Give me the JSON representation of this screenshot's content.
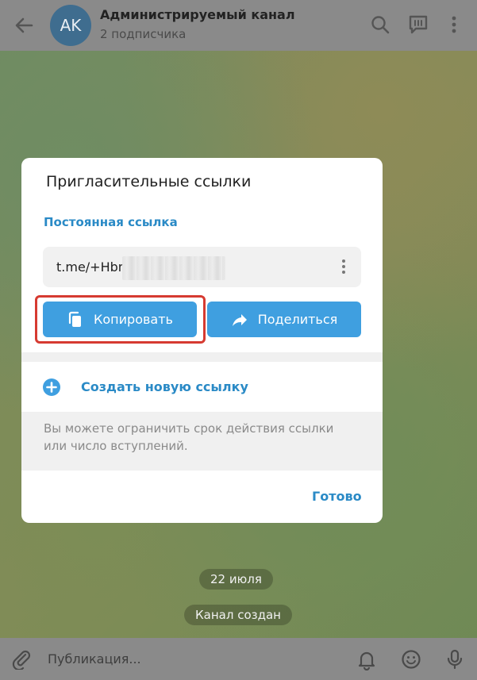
{
  "header": {
    "avatar_initials": "AK",
    "title": "Администрируемый канал",
    "subtitle": "2 подписчика"
  },
  "chat": {
    "date_pill": "22 июля",
    "system_message": "Канал создан"
  },
  "composer": {
    "placeholder": "Публикация..."
  },
  "dialog": {
    "title": "Пригласительные ссылки",
    "section_label": "Постоянная ссылка",
    "link_text": "t.me/+Hbm",
    "copy_button": "Копировать",
    "share_button": "Поделиться",
    "create_new_link": "Создать новую ссылку",
    "note": "Вы можете ограничить срок действия ссылки или число вступлений.",
    "done_button": "Готово"
  },
  "colors": {
    "accent": "#3f9fe0",
    "link_blue": "#2a8ac6",
    "highlight_red": "#d63a31"
  },
  "icons": [
    "back-arrow-icon",
    "search-icon",
    "chat-icon",
    "more-vert-icon",
    "copy-icon",
    "share-icon",
    "plus-circle-icon",
    "kebab-icon",
    "attach-icon",
    "bell-icon",
    "smile-icon",
    "mic-icon"
  ]
}
